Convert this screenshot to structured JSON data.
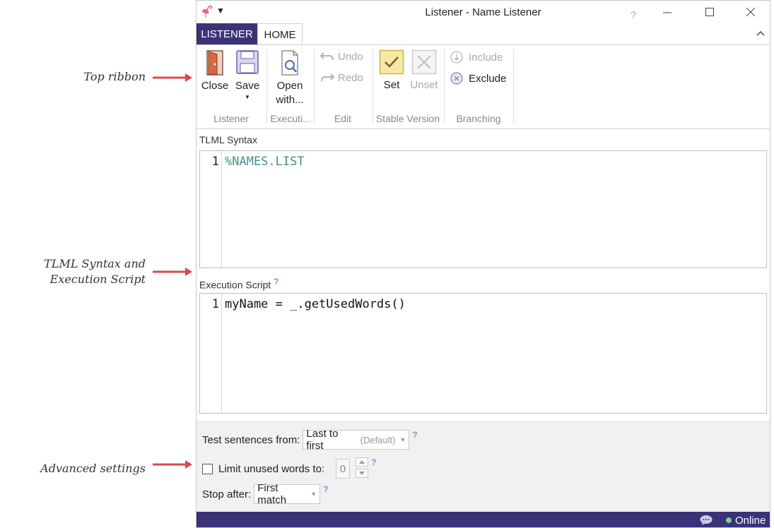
{
  "annotations": {
    "top_ribbon": "Top ribbon",
    "tlml_line1": "TLML Syntax and",
    "tlml_line2": "Execution Script",
    "advanced": "Advanced settings"
  },
  "window": {
    "title": "Listener - Name Listener",
    "help": "?"
  },
  "tabs": {
    "listener": "LISTENER",
    "home": "HOME"
  },
  "ribbon": {
    "groups": {
      "listener": "Listener",
      "execution": "Executi...",
      "edit": "Edit",
      "stable_version": "Stable Version",
      "branching": "Branching"
    },
    "close": "Close",
    "save": "Save",
    "open_line1": "Open",
    "open_line2": "with...",
    "undo": "Undo",
    "redo": "Redo",
    "set": "Set",
    "unset": "Unset",
    "include": "Include",
    "exclude": "Exclude"
  },
  "tlml": {
    "label": "TLML Syntax",
    "line_number": "1",
    "code": "%NAMES.LIST"
  },
  "script": {
    "label": "Execution Script",
    "help": "?",
    "line_number": "1",
    "code": "myName = _.getUsedWords()"
  },
  "advanced": {
    "test_label": "Test sentences from:",
    "test_value": "Last to first",
    "test_default": "(Default)",
    "limit_label": "Limit unused words to:",
    "limit_value": "0",
    "stop_label": "Stop after:",
    "stop_value": "First match",
    "help": "?"
  },
  "status": {
    "online": "Online"
  },
  "colors": {
    "brand": "#3b3378",
    "code_keyword": "#4a8f8a",
    "help": "#6a9bd8",
    "set_fill": "#f6e9a8",
    "set_border": "#d4b043"
  }
}
